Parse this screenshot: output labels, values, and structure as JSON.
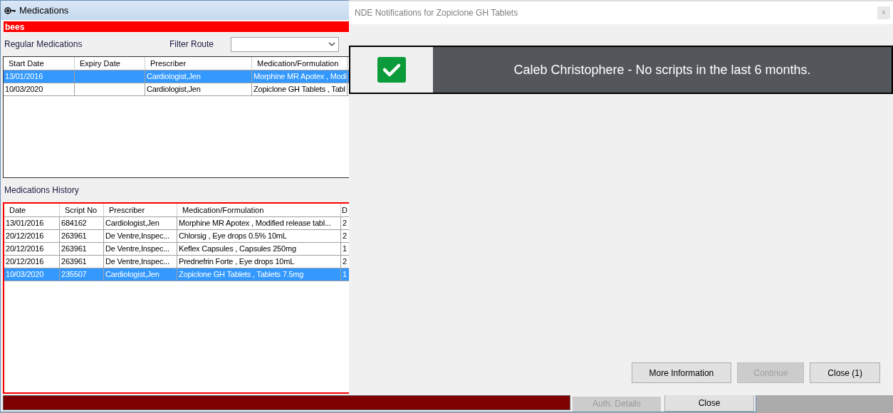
{
  "window": {
    "title": "Medications"
  },
  "alert_banner": "bees",
  "regular_medications": {
    "label": "Regular Medications",
    "filter_label": "Filter Route",
    "columns": [
      "Start Date",
      "Expiry Date",
      "Prescriber",
      "Medication/Formulation"
    ],
    "rows": [
      {
        "cells": [
          "13/01/2016",
          null,
          "Cardiologist,Jen",
          "Morphine MR Apotex , Modi"
        ],
        "selected": true
      },
      {
        "cells": [
          "10/03/2020",
          null,
          "Cardiologist,Jen",
          "Zopiclone GH Tablets , Tabl"
        ],
        "selected": false
      }
    ]
  },
  "medications_history": {
    "label": "Medications History",
    "columns": [
      "Date",
      "Script No",
      "Prescriber",
      "Medication/Formulation",
      "D"
    ],
    "rows": [
      {
        "cells": [
          "13/01/2016",
          "684162",
          "Cardiologist,Jen",
          "Morphine MR Apotex , Modified release tabl...",
          "2"
        ],
        "selected": false
      },
      {
        "cells": [
          "20/12/2016",
          "263961",
          "De Ventre,Inspec...",
          "Chlorsig , Eye drops 0.5% 10mL",
          "2"
        ],
        "selected": false
      },
      {
        "cells": [
          "20/12/2016",
          "263961",
          "De Ventre,Inspec...",
          "Keflex Capsules , Capsules 250mg",
          "1"
        ],
        "selected": false
      },
      {
        "cells": [
          "20/12/2016",
          "263961",
          "De Ventre,Inspec...",
          "Prednefrin Forte , Eye drops 10mL",
          "2"
        ],
        "selected": false
      },
      {
        "cells": [
          "10/03/2020",
          "235507",
          "Cardiologist,Jen",
          "Zopiclone GH Tablets , Tablets 7.5mg",
          "1"
        ],
        "selected": true
      }
    ]
  },
  "footer_buttons": [
    {
      "label": "Auth. Details",
      "disabled": true
    },
    {
      "label": "Close",
      "disabled": false
    }
  ],
  "dialog": {
    "title": "NDE Notifications for Zopiclone GH Tablets",
    "close": "x",
    "notification": {
      "kind": "success",
      "message": "Caleb Christophere - No scripts in the last 6 months."
    },
    "buttons": [
      {
        "label": "More Information",
        "disabled": false
      },
      {
        "label": "Continue",
        "disabled": true
      },
      {
        "label": "Close (1)",
        "disabled": false
      }
    ]
  }
}
